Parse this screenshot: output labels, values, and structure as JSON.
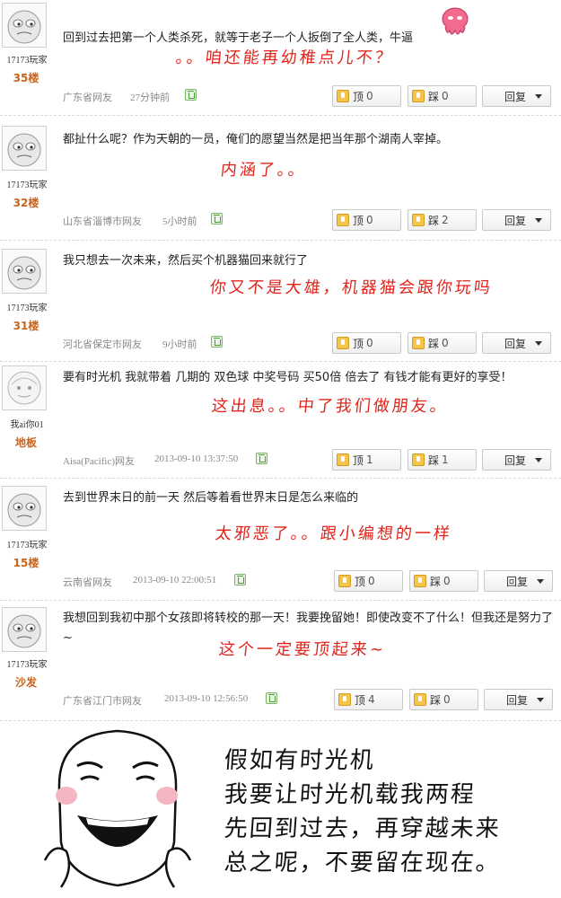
{
  "posts": [
    {
      "username": "17173玩家",
      "floor": "35楼",
      "comment": "回到过去把第一个人类杀死，就等于老子一个人扳倒了全人类，牛逼",
      "note": "。。咱还能再幼稚点儿不？",
      "location": "广东省网友",
      "time": "27分钟前",
      "up_label": "顶",
      "up_count": "0",
      "down_label": "踩",
      "down_count": "0",
      "reply_label": "回复"
    },
    {
      "username": "17173玩家",
      "floor": "32楼",
      "comment": "都扯什么呢？作为天朝的一员，俺们的愿望当然是把当年那个湖南人宰掉。",
      "note": "内涵了。。",
      "location": "山东省淄博市网友",
      "time": "5小时前",
      "up_label": "顶",
      "up_count": "0",
      "down_label": "踩",
      "down_count": "2",
      "reply_label": "回复"
    },
    {
      "username": "17173玩家",
      "floor": "31楼",
      "comment": "我只想去一次未来，然后买个机器猫回来就行了",
      "note": "你又不是大雄，机器猫会跟你玩吗",
      "location": "河北省保定市网友",
      "time": "9小时前",
      "up_label": "顶",
      "up_count": "0",
      "down_label": "踩",
      "down_count": "0",
      "reply_label": "回复"
    },
    {
      "username": "我ai你01",
      "floor": "地板",
      "comment": "要有时光机 我就带着 几期的 双色球 中奖号码 买50倍 倍去了 有钱才能有更好的享受！",
      "note": "这出息。。中了我们做朋友。",
      "location": "Aisa(Pacific)网友",
      "time": "2013-09-10 13:37:50",
      "up_label": "顶",
      "up_count": "1",
      "down_label": "踩",
      "down_count": "1",
      "reply_label": "回复"
    },
    {
      "username": "17173玩家",
      "floor": "15楼",
      "comment": "去到世界末日的前一天 然后等着看世界末日是怎么来临的",
      "note": "太邪恶了。。跟小编想的一样",
      "location": "云南省网友",
      "time": "2013-09-10 22:00:51",
      "up_label": "顶",
      "up_count": "0",
      "down_label": "踩",
      "down_count": "0",
      "reply_label": "回复"
    },
    {
      "username": "17173玩家",
      "floor": "沙发",
      "comment": "我想回到我初中那个女孩即将转校的那一天！我要挽留她！即使改变不了什么！但我还是努力了~",
      "note": "这个一定要顶起来~",
      "location": "广东省江门市网友",
      "time": "2013-09-10 12:56:50",
      "up_label": "顶",
      "up_count": "4",
      "down_label": "踩",
      "down_count": "0",
      "reply_label": "回复"
    }
  ],
  "closing": {
    "lines": [
      "假如有时光机",
      "我要让时光机载我两程",
      "先回到过去，再穿越未来",
      "总之呢，不要留在现在。"
    ]
  },
  "colors": {
    "note_red": "#e0241b",
    "floor_orange": "#c8641e",
    "trash_green": "#4f9a3d"
  },
  "icons": {
    "avatar": "default-avatar-face-icon",
    "trash": "trash-icon",
    "up": "thumb-up-icon",
    "down": "thumb-down-icon",
    "reply_dropdown": "caret-down-icon",
    "mascot": "octopus-mascot-icon"
  }
}
